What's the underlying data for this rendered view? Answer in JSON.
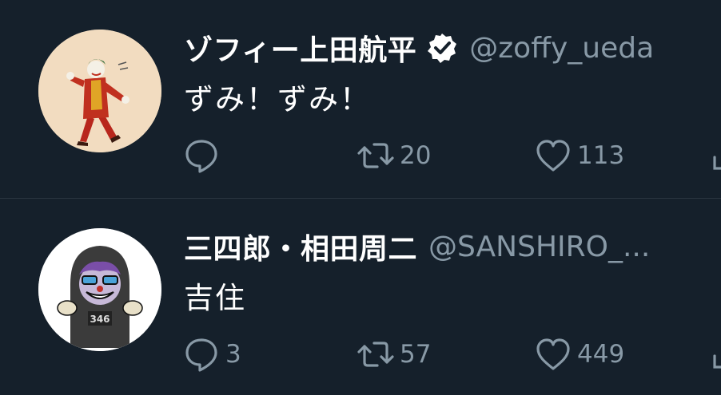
{
  "tweets": [
    {
      "display_name": "ゾフィー上田航平",
      "verified": true,
      "handle": "@zoffy_ueda",
      "text": "ずみ！ずみ！",
      "reply_count": "",
      "retweet_count": "20",
      "like_count": "113",
      "avatar_icon": "joker-dancing-avatar"
    },
    {
      "display_name": "三四郎・相田周二",
      "verified": false,
      "handle": "@SANSHIRO_...",
      "text": "吉住",
      "reply_count": "3",
      "retweet_count": "57",
      "like_count": "449",
      "avatar_icon": "hooded-character-avatar"
    }
  ],
  "colors": {
    "background": "#15202b",
    "text_primary": "#ffffff",
    "text_secondary": "#8899a6",
    "divider": "#2b3640"
  },
  "icons": {
    "reply": "reply-icon",
    "retweet": "retweet-icon",
    "like": "heart-icon",
    "share": "share-icon",
    "verified": "verified-badge-icon"
  }
}
